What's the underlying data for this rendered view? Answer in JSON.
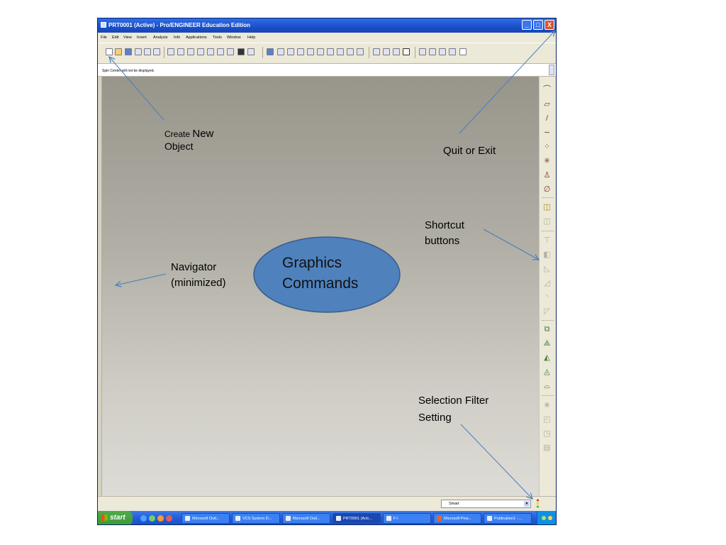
{
  "window": {
    "title": "PRT0001 (Active) - Pro/ENGINEER Education Edition",
    "controls": {
      "minimize": "_",
      "maximize": "□",
      "close": "X"
    }
  },
  "menu": [
    "File",
    "Edit",
    "View",
    "Insert",
    "Analysis",
    "Info",
    "Applications",
    "Tools",
    "Window",
    "Help"
  ],
  "toolbar_icons": [
    "new-icon",
    "open-icon",
    "save-icon",
    "print-icon",
    "email-icon",
    "email-attach-icon",
    "undo-icon",
    "redo-icon",
    "cut-icon",
    "copy-icon",
    "paste-icon",
    "paste-special-icon",
    "regenerate-icon",
    "find-icon",
    "select-box-icon",
    "repaint-icon",
    "spin-center-icon",
    "orient-icon",
    "zoom-in-icon",
    "zoom-out-icon",
    "refit-icon",
    "reorient-icon",
    "saved-views-icon",
    "layers-icon",
    "view-manager-icon",
    "wireframe-icon",
    "hidden-line-icon",
    "no-hidden-icon",
    "shading-icon",
    "datum-planes-icon",
    "datum-axes-icon",
    "datum-points-icon",
    "coord-sys-icon",
    "context-help-icon"
  ],
  "message": {
    "text": "Spin Center will not be displayed."
  },
  "right_toolbar_icons": [
    "sketch-icon",
    "datum-plane-icon",
    "datum-axis-icon",
    "datum-curve-icon",
    "datum-point-icon",
    "datum-csys-icon",
    "datum-analysis-icon",
    "datum-edit-icon",
    "extrude-icon",
    "revolve-icon",
    "hole-icon",
    "shell-icon",
    "rib-icon",
    "draft-icon",
    "round-icon",
    "chamfer-icon",
    "copy-feature-icon",
    "mirror-icon",
    "merge-icon",
    "trim-icon",
    "intersect-icon",
    "pattern-icon",
    "offset-icon",
    "thicken-icon",
    "solidify-icon"
  ],
  "selection_filter": {
    "value": "Smart"
  },
  "taskbar": {
    "start_label": "start",
    "tasks": [
      "Microsoft Outl...",
      "VCS System D...",
      "Microsoft Outl...",
      "PRT0001 (Acti...",
      "F:\\",
      "Microsoft Pow...",
      "Publication1 - ..."
    ]
  },
  "callouts": {
    "create_new_prefix": "Create ",
    "create_new_emph": "New",
    "create_new_line2": "Object",
    "quit_exit": "Quit or Exit",
    "shortcut_line1": "Shortcut",
    "shortcut_line2": "buttons",
    "navigator_line1": "Navigator",
    "navigator_line2": "(minimized)",
    "graphics_line1": "Graphics",
    "graphics_line2": "Commands",
    "selection_line1": "Selection Filter",
    "selection_line2": "Setting"
  },
  "colors": {
    "titlebar": "#245edb",
    "close_button": "#d9532c",
    "graphics_top": "#98958b",
    "graphics_bottom": "#dddcd6",
    "callout_arrow": "#4a7ebb",
    "ellipse_fill": "#4f81bd",
    "ellipse_stroke": "#385d8a"
  }
}
